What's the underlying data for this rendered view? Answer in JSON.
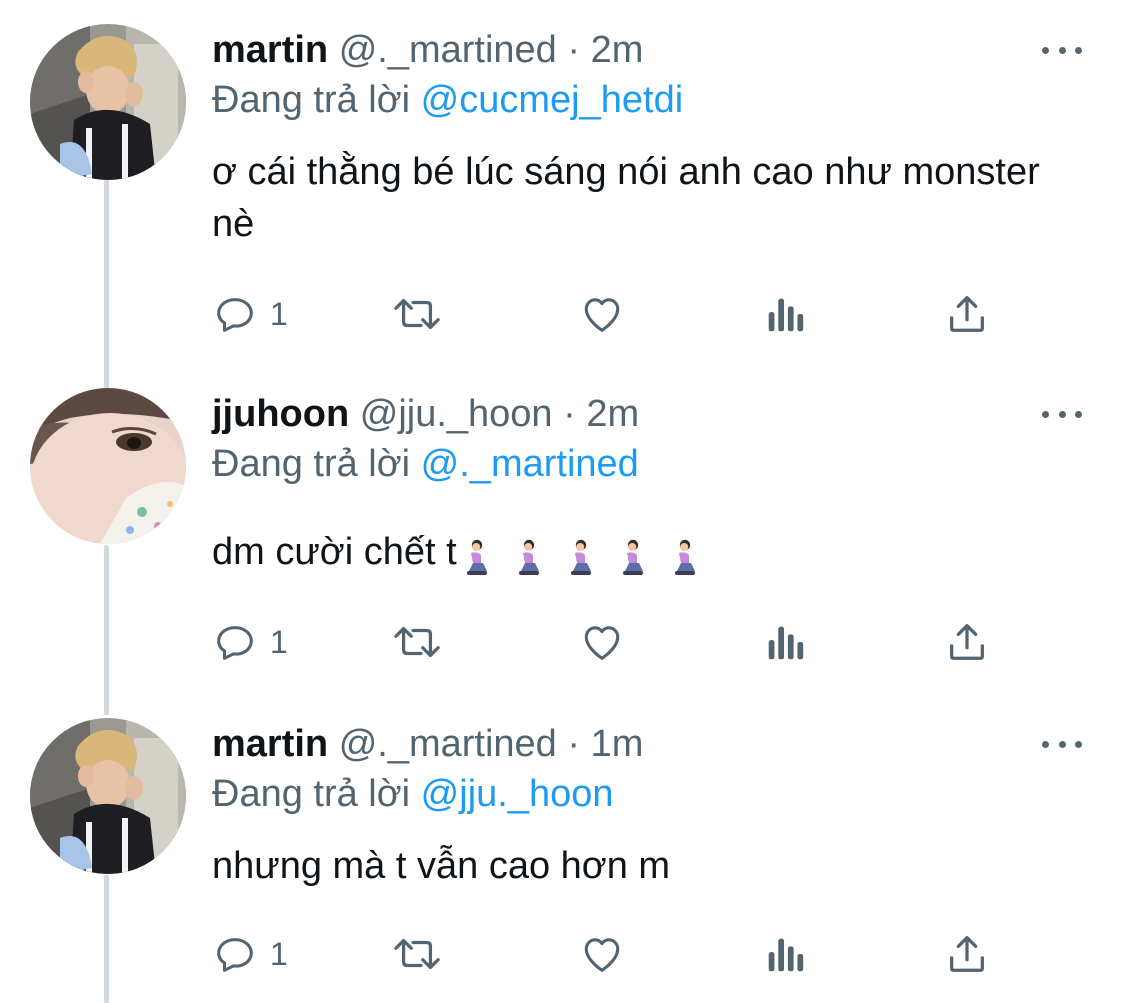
{
  "colors": {
    "text": "#0f1419",
    "secondary": "#536471",
    "link": "#1d9bf0",
    "thread_line": "#cfd9de"
  },
  "tweets": [
    {
      "display_name": "martin",
      "handle": "@._martined",
      "separator": "·",
      "time": "2m",
      "reply_prefix": "Đang trả lời ",
      "reply_to": "@cucmej_hetdi",
      "text": "ơ cái thằng bé lúc sáng nói anh cao như monster nè",
      "reply_count": "1",
      "avatar": "martin-avatar"
    },
    {
      "display_name": "jjuhoon",
      "handle": "@jju._hoon",
      "separator": "·",
      "time": "2m",
      "reply_prefix": "Đang trả lời ",
      "reply_to": "@._martined",
      "text": "dm cười chết t",
      "emoji": "person-kneeling",
      "emoji_count": 5,
      "reply_count": "1",
      "avatar": "jjuhoon-avatar"
    },
    {
      "display_name": "martin",
      "handle": "@._martined",
      "separator": "·",
      "time": "1m",
      "reply_prefix": "Đang trả lời ",
      "reply_to": "@jju._hoon",
      "text": "nhưng mà t vẫn cao hơn m",
      "reply_count": "1",
      "avatar": "martin-avatar"
    }
  ],
  "action_icons": [
    "reply-icon",
    "retweet-icon",
    "like-icon",
    "views-icon",
    "share-icon"
  ]
}
